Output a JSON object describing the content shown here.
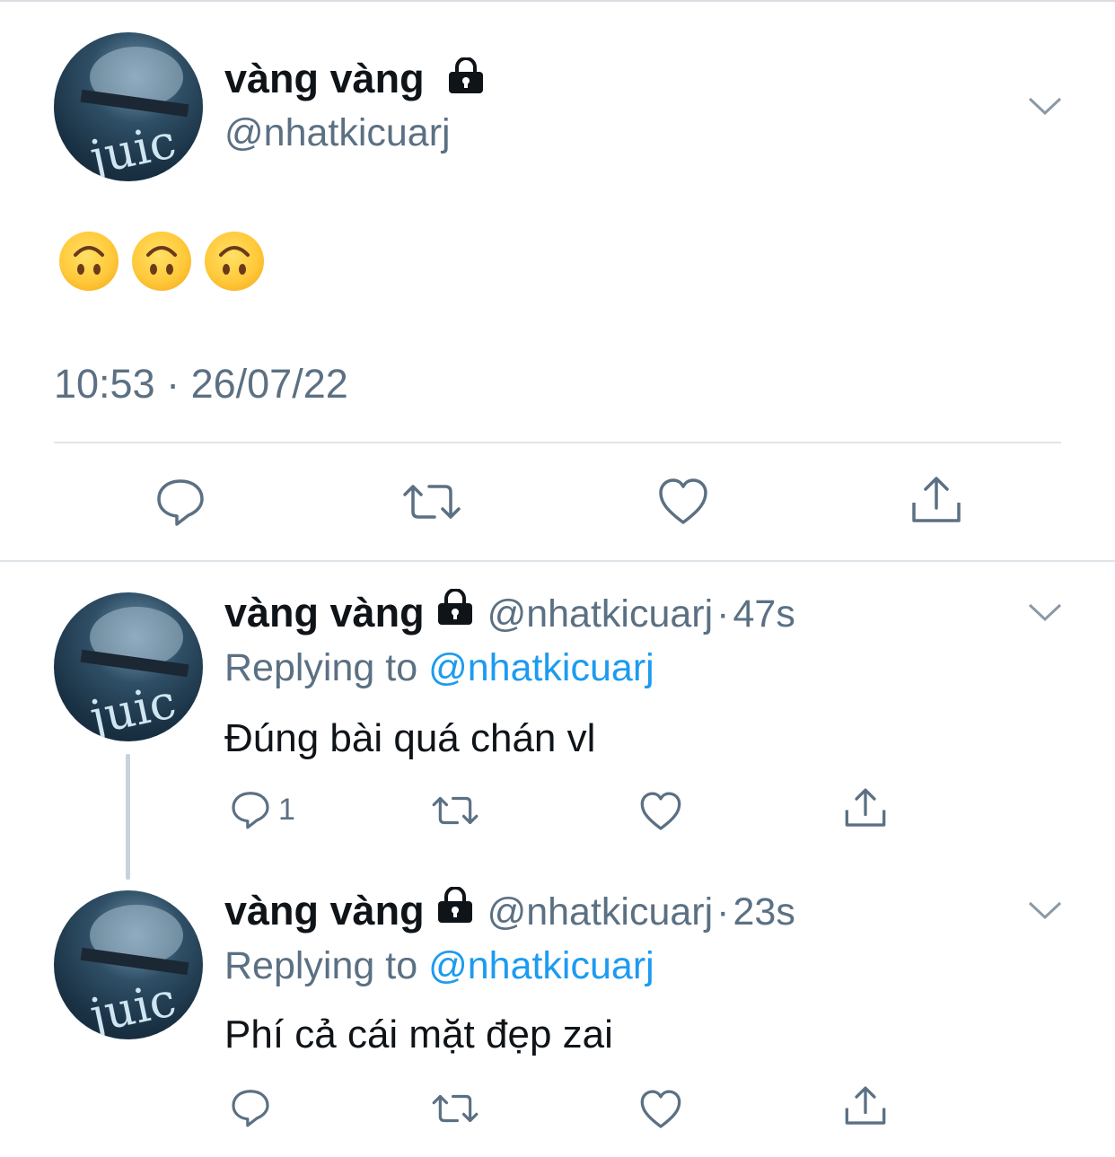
{
  "main_tweet": {
    "display_name": "vàng vàng",
    "handle": "@nhatkicuarj",
    "content_emoji": [
      "upside-down-face-emoji",
      "upside-down-face-emoji",
      "upside-down-face-emoji"
    ],
    "timestamp": "10:53 · 26/07/22"
  },
  "replies": [
    {
      "display_name": "vàng vàng",
      "handle": "@nhatkicuarj",
      "separator": "·",
      "age": "47s",
      "replying_prefix": "Replying to",
      "replying_to": "@nhatkicuarj",
      "text": "Đúng bài quá chán vl",
      "reply_count": "1"
    },
    {
      "display_name": "vàng vàng",
      "handle": "@nhatkicuarj",
      "separator": "·",
      "age": "23s",
      "replying_prefix": "Replying to",
      "replying_to": "@nhatkicuarj",
      "text": "Phí cả cái mặt đẹp zai",
      "reply_count": ""
    }
  ],
  "icons": {
    "lock": "lock-icon",
    "more": "chevron-down-icon",
    "reply": "reply-icon",
    "retweet": "retweet-icon",
    "like": "heart-icon",
    "share": "share-icon"
  },
  "colors": {
    "link": "#1d9bf0",
    "secondary_text": "#5b7083",
    "divider": "#dfe4e8"
  }
}
